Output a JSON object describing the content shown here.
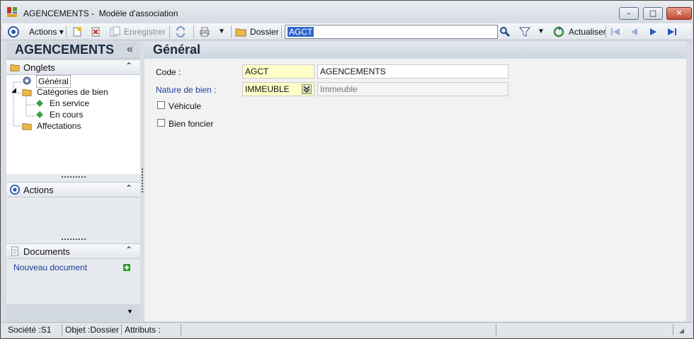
{
  "window": {
    "title": "AGENCEMENTS -  Modèle d'association",
    "minimize": "–",
    "maximize": "□",
    "close": "✕"
  },
  "toolbar": {
    "actions_label": "Actions",
    "save_label": "Enregistrer",
    "folder_label": "Dossier",
    "search_value": "AGCT",
    "refresh_label": "Actualiser"
  },
  "left_panel": {
    "title": "AGENCEMENTS",
    "collapse_glyph": "«",
    "tabs_section": {
      "title": "Onglets",
      "items": [
        {
          "label": "Général",
          "icon": "tools-icon"
        },
        {
          "label": "Catégories de bien",
          "icon": "folder-icon"
        },
        {
          "label": "En service",
          "icon": "diamond-icon"
        },
        {
          "label": "En cours",
          "icon": "diamond-icon"
        },
        {
          "label": "Affectations",
          "icon": "folder-icon"
        }
      ]
    },
    "actions_section": {
      "title": "Actions"
    },
    "documents_section": {
      "title": "Documents",
      "new_document": "Nouveau document"
    }
  },
  "content": {
    "title": "Général",
    "code_label": "Code :",
    "code_value": "AGCT",
    "code_description": "AGENCEMENTS",
    "nature_label": "Nature de bien :",
    "nature_value": "IMMEUBLE",
    "nature_description": "Immeuble",
    "vehicule_label": "Véhicule",
    "vehicule_checked": false,
    "foncier_label": "Bien foncier",
    "foncier_checked": false
  },
  "status_bar": {
    "societe": "Société :S1",
    "objet": "Objet :Dossier",
    "attributs": "Attributs :"
  },
  "colors": {
    "required_field": "#ffffc8",
    "link_blue": "#1c3c9c",
    "selection": "#3366cc"
  }
}
